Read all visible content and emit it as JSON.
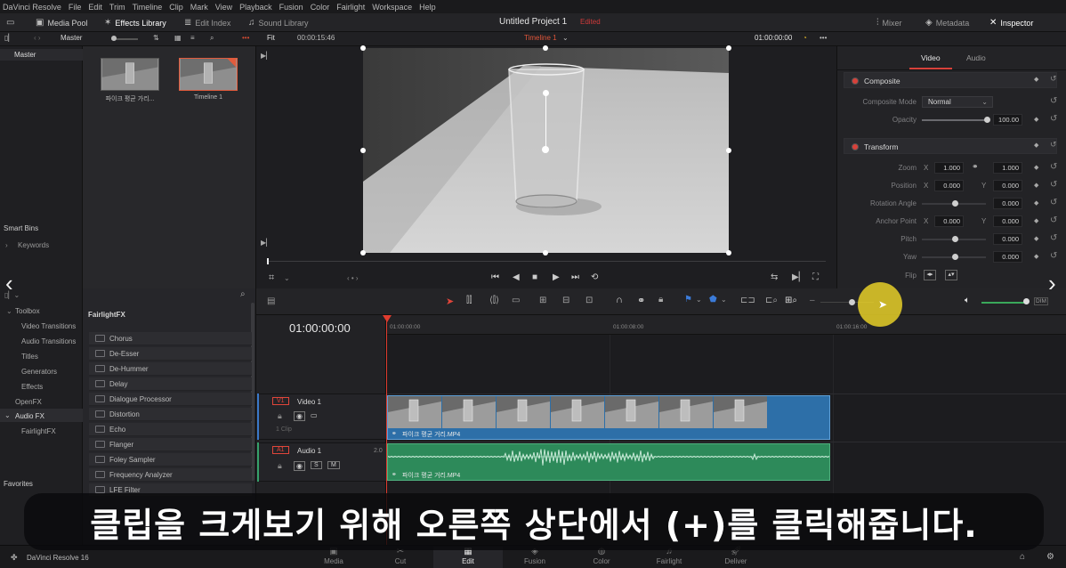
{
  "menu": [
    "DaVinci Resolve",
    "File",
    "Edit",
    "Trim",
    "Timeline",
    "Clip",
    "Mark",
    "View",
    "Playback",
    "Fusion",
    "Color",
    "Fairlight",
    "Workspace",
    "Help"
  ],
  "toolbar": {
    "media_pool": "Media Pool",
    "effects_library": "Effects Library",
    "edit_index": "Edit Index",
    "sound_library": "Sound Library",
    "project_title": "Untitled Project 1",
    "edited": "Edited",
    "mixer": "Mixer",
    "metadata": "Metadata",
    "inspector": "Inspector"
  },
  "toolbar2": {
    "bin_name": "Master",
    "fit": "Fit",
    "source_tc": "00:00:15:46",
    "timeline_name": "Timeline 1",
    "record_tc": "01:00:00:00"
  },
  "bins": {
    "master": "Master",
    "smart_bins": "Smart Bins",
    "keywords": "Keywords"
  },
  "media_pool": {
    "clips": [
      {
        "label": "파이크 평균 가리..."
      },
      {
        "label": "Timeline 1"
      }
    ]
  },
  "inspector": {
    "tabs": [
      "Video",
      "Audio"
    ],
    "composite": {
      "header": "Composite",
      "mode_label": "Composite Mode",
      "mode_value": "Normal",
      "opacity_label": "Opacity",
      "opacity_value": "100.00"
    },
    "transform": {
      "header": "Transform",
      "zoom_label": "Zoom",
      "zoom_x": "1.000",
      "zoom_y": "1.000",
      "position_label": "Position",
      "position_x": "0.000",
      "position_y": "0.000",
      "rotation_label": "Rotation Angle",
      "rotation_value": "0.000",
      "anchor_label": "Anchor Point",
      "anchor_x": "0.000",
      "anchor_y": "0.000",
      "pitch_label": "Pitch",
      "pitch_value": "0.000",
      "yaw_label": "Yaw",
      "yaw_value": "0.000",
      "flip_label": "Flip"
    },
    "axis_x": "X",
    "axis_y": "Y"
  },
  "fx_tree": {
    "toolbox": "Toolbox",
    "video_transitions": "Video Transitions",
    "audio_transitions": "Audio Transitions",
    "titles": "Titles",
    "generators": "Generators",
    "effects": "Effects",
    "openfx": "OpenFX",
    "audio_fx": "Audio FX",
    "fairlightfx": "FairlightFX",
    "favorites": "Favorites"
  },
  "fx_list": {
    "header": "FairlightFX",
    "items": [
      "Chorus",
      "De-Esser",
      "De-Hummer",
      "Delay",
      "Dialogue Processor",
      "Distortion",
      "Echo",
      "Flanger",
      "Foley Sampler",
      "Frequency Analyzer",
      "LFE Filter"
    ]
  },
  "timeline": {
    "timecode": "01:00:00:00",
    "ruler": [
      "01:00:00:00",
      "01:00:08:00",
      "01:00:16:00"
    ],
    "video_track": {
      "id": "V1",
      "name": "Video 1",
      "clips": "1 Clip"
    },
    "audio_track": {
      "id": "A1",
      "name": "Audio 1",
      "level": "2.0"
    },
    "video_clip_name": "파이크 평균 거리.MP4",
    "audio_clip_name": "파이크 평균 거리.MP4"
  },
  "pages": [
    "Media",
    "Cut",
    "Edit",
    "Fusion",
    "Color",
    "Fairlight",
    "Deliver"
  ],
  "active_page": "Edit",
  "footer": {
    "app": "DaVinci Resolve 16"
  },
  "subtitle": "클립을 크게보기 위해 오른쪽 상단에서 (+)를 클릭해줍니다.",
  "colors": {
    "accent_red": "#e03c2f",
    "video_clip": "#2d6fa8",
    "audio_clip": "#2d8a5a",
    "cursor": "#eed628"
  }
}
